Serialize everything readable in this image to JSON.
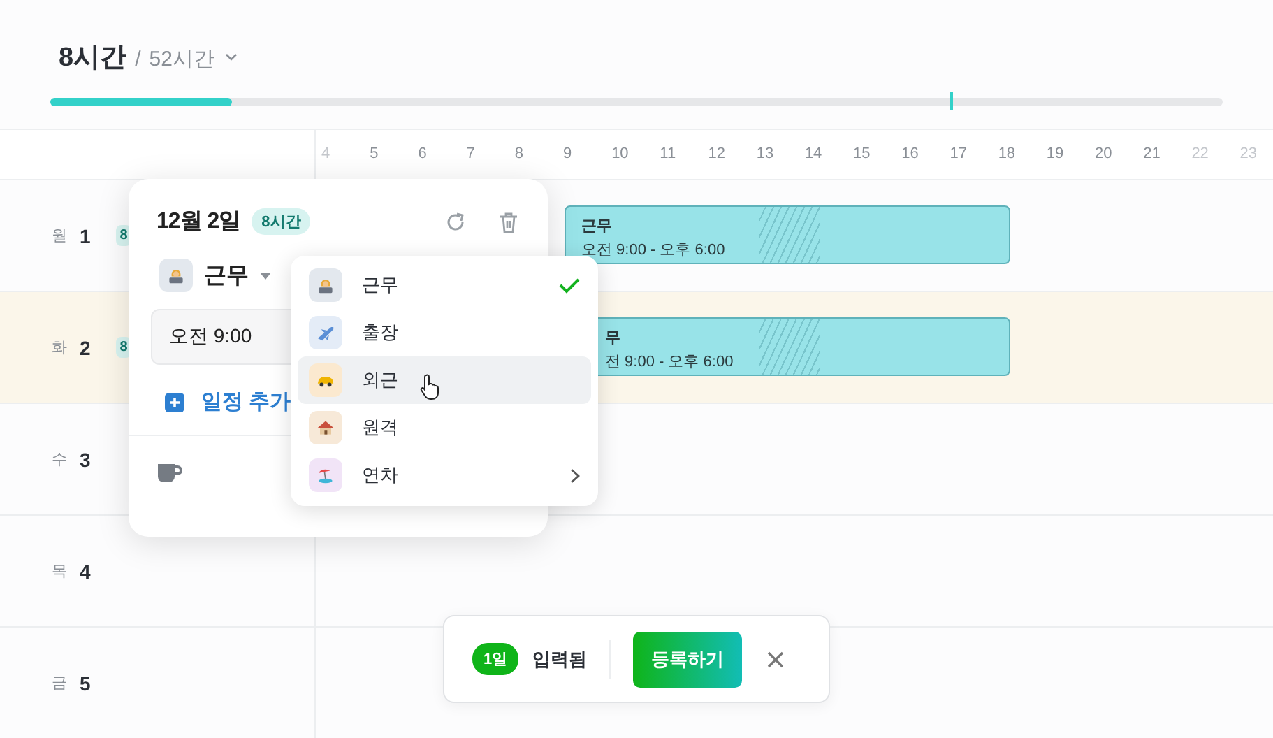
{
  "summary": {
    "worked": "8시간",
    "separator": "/",
    "total": "52시간",
    "level": 0.155
  },
  "hours": [
    {
      "label": "4",
      "dim": true
    },
    {
      "label": "5",
      "dim": false
    },
    {
      "label": "6",
      "dim": false
    },
    {
      "label": "7",
      "dim": false
    },
    {
      "label": "8",
      "dim": false
    },
    {
      "label": "9",
      "dim": false
    },
    {
      "label": "10",
      "dim": false
    },
    {
      "label": "11",
      "dim": false
    },
    {
      "label": "12",
      "dim": false
    },
    {
      "label": "13",
      "dim": false
    },
    {
      "label": "14",
      "dim": false
    },
    {
      "label": "15",
      "dim": false
    },
    {
      "label": "16",
      "dim": false
    },
    {
      "label": "17",
      "dim": false
    },
    {
      "label": "18",
      "dim": false
    },
    {
      "label": "19",
      "dim": false
    },
    {
      "label": "20",
      "dim": false
    },
    {
      "label": "21",
      "dim": false
    },
    {
      "label": "22",
      "dim": true
    },
    {
      "label": "23",
      "dim": true
    }
  ],
  "days": [
    {
      "weekday": "월",
      "date": "1",
      "badge": "8",
      "selected": false,
      "events": [
        {
          "title": "근무",
          "time": "오전 9:00 - 오후 6:00"
        }
      ]
    },
    {
      "weekday": "화",
      "date": "2",
      "badge": "8",
      "selected": true,
      "events": [
        {
          "title": "무",
          "time": "전 9:00 - 오후 6:00"
        }
      ]
    },
    {
      "weekday": "수",
      "date": "3",
      "selected": false
    },
    {
      "weekday": "목",
      "date": "4",
      "selected": false
    },
    {
      "weekday": "금",
      "date": "5",
      "selected": false
    }
  ],
  "popover": {
    "date": "12월 2일",
    "badge": "8시간",
    "type": "근무",
    "time": "오전 9:00",
    "add_label": "일정 추가"
  },
  "menu": {
    "items": [
      {
        "label": "근무",
        "kind": "work",
        "selected": true,
        "hovered": false,
        "submenu": false
      },
      {
        "label": "출장",
        "kind": "trip",
        "selected": false,
        "hovered": false,
        "submenu": false
      },
      {
        "label": "외근",
        "kind": "outside",
        "selected": false,
        "hovered": true,
        "submenu": false
      },
      {
        "label": "원격",
        "kind": "remote",
        "selected": false,
        "hovered": false,
        "submenu": false
      },
      {
        "label": "연차",
        "kind": "leave",
        "selected": false,
        "hovered": false,
        "submenu": true
      }
    ]
  },
  "toast": {
    "count": "1일",
    "status": "입력됨",
    "button": "등록하기"
  }
}
